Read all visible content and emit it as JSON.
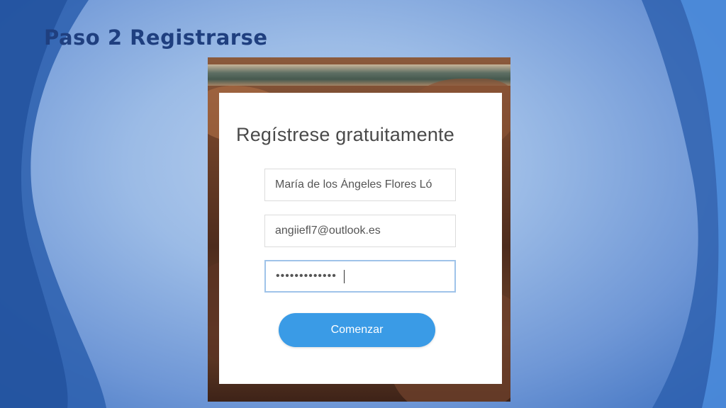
{
  "slide": {
    "title": "Paso 2 Registrarse"
  },
  "signup": {
    "heading": "Regístrese gratuitamente",
    "name_value": "María de los Ángeles Flores Ló",
    "email_value": "angiiefl7@outlook.es",
    "password_value": "•••••••••••••",
    "submit_label": "Comenzar"
  },
  "colors": {
    "title": "#1f3f7f",
    "button": "#3a9be6",
    "active_field_border": "#9fc3e9"
  }
}
